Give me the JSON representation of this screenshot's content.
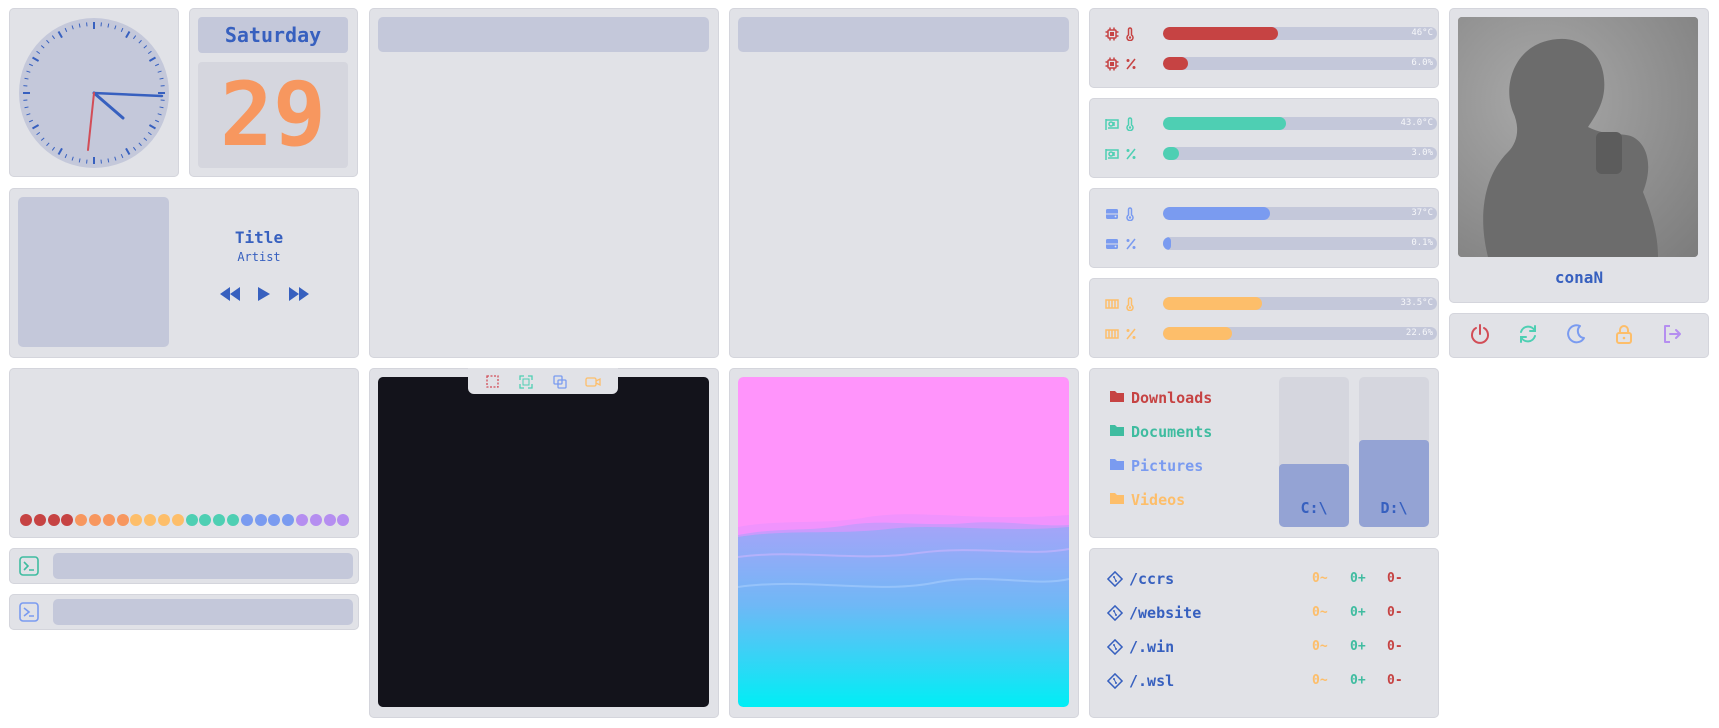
{
  "date": {
    "weekday": "Saturday",
    "day": "29"
  },
  "music": {
    "title": "Title",
    "artist": "Artist",
    "controls": [
      "previous-icon",
      "play-icon",
      "next-icon"
    ]
  },
  "stats": [
    {
      "icon": "cpu-icon",
      "kind": "temperature",
      "value_label": "46°C",
      "fraction": 0.42,
      "color": "#c64343"
    },
    {
      "icon": "cpu-icon",
      "kind": "usage",
      "value_label": "6.0%",
      "fraction": 0.09,
      "color": "#c64343"
    },
    {
      "icon": "gpu-icon",
      "kind": "temperature",
      "value_label": "43.0°C",
      "fraction": 0.45,
      "color": "#4ecfb3"
    },
    {
      "icon": "gpu-icon",
      "kind": "usage",
      "value_label": "3.0%",
      "fraction": 0.06,
      "color": "#4ecfb3"
    },
    {
      "icon": "disk-icon",
      "kind": "temperature",
      "value_label": "37°C",
      "fraction": 0.39,
      "color": "#7a9bf0"
    },
    {
      "icon": "disk-icon",
      "kind": "usage",
      "value_label": "0.1%",
      "fraction": 0.03,
      "color": "#7a9bf0"
    },
    {
      "icon": "ram-icon",
      "kind": "temperature",
      "value_label": "33.5°C",
      "fraction": 0.36,
      "color": "#fdbe6a"
    },
    {
      "icon": "ram-icon",
      "kind": "usage",
      "value_label": "22.6%",
      "fraction": 0.25,
      "color": "#fdbe6a"
    }
  ],
  "profile": {
    "name": "conaN"
  },
  "power_buttons": [
    {
      "name": "power-icon",
      "color": "#d24d57"
    },
    {
      "name": "restart-icon",
      "color": "#4ecfb3"
    },
    {
      "name": "moon-icon",
      "color": "#7a9bf0"
    },
    {
      "name": "lock-icon",
      "color": "#fdbe6a"
    },
    {
      "name": "logout-icon",
      "color": "#b58ef0"
    }
  ],
  "folders": [
    {
      "label": "Downloads",
      "color": "#c64343"
    },
    {
      "label": "Documents",
      "color": "#3fbca0"
    },
    {
      "label": "Pictures",
      "color": "#7a9bf0"
    },
    {
      "label": "Videos",
      "color": "#fdbe6a"
    }
  ],
  "drives": [
    {
      "label": "C:\\",
      "fraction": 0.42
    },
    {
      "label": "D:\\",
      "fraction": 0.58
    }
  ],
  "repos": [
    {
      "name": "/ccrs",
      "modified": "0~",
      "added": "0+",
      "deleted": "0-"
    },
    {
      "name": "/website",
      "modified": "0~",
      "added": "0+",
      "deleted": "0-"
    },
    {
      "name": "/.win",
      "modified": "0~",
      "added": "0+",
      "deleted": "0-"
    },
    {
      "name": "/.wsl",
      "modified": "0~",
      "added": "0+",
      "deleted": "0-"
    }
  ],
  "repo_colors": {
    "modified": "#fdbe6a",
    "added": "#3fbca0",
    "deleted": "#c64343"
  },
  "palette": [
    "#c64343",
    "#c64343",
    "#c64343",
    "#c64343",
    "#f7975f",
    "#f7975f",
    "#f7975f",
    "#f7975f",
    "#fdbe6a",
    "#fdbe6a",
    "#fdbe6a",
    "#fdbe6a",
    "#4ecfb3",
    "#4ecfb3",
    "#4ecfb3",
    "#4ecfb3",
    "#7a9bf0",
    "#7a9bf0",
    "#7a9bf0",
    "#7a9bf0",
    "#b58ef0",
    "#b58ef0",
    "#b58ef0",
    "#b58ef0"
  ],
  "screenshot_tools": [
    {
      "name": "region-select-icon",
      "color": "#d24d57"
    },
    {
      "name": "fullscreen-capture-icon",
      "color": "#4ecfb3"
    },
    {
      "name": "window-capture-icon",
      "color": "#7a9bf0"
    },
    {
      "name": "record-icon",
      "color": "#fdbe6a"
    }
  ],
  "terminals": [
    {
      "icon": "terminal-icon",
      "color": "#3fbca0"
    },
    {
      "icon": "powershell-icon",
      "color": "#7a9bf0"
    }
  ]
}
